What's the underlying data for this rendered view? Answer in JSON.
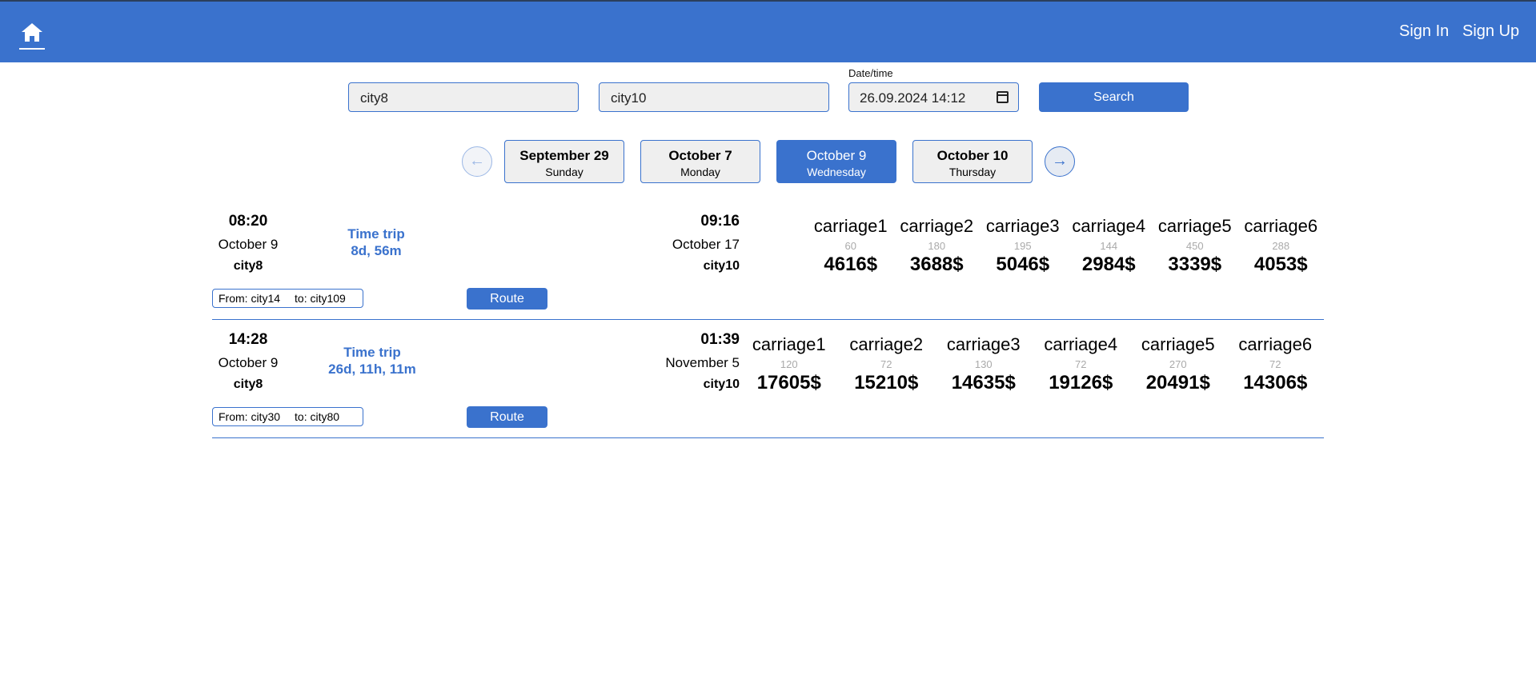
{
  "header": {
    "sign_in": "Sign In",
    "sign_up": "Sign Up"
  },
  "search": {
    "from": "city8",
    "to": "city10",
    "date_label": "Date/time",
    "date_value": "26.09.2024 14:12",
    "button": "Search"
  },
  "dates": [
    {
      "date": "September 29",
      "weekday": "Sunday"
    },
    {
      "date": "October 7",
      "weekday": "Monday"
    },
    {
      "date": "October 9",
      "weekday": "Wednesday"
    },
    {
      "date": "October 10",
      "weekday": "Thursday"
    }
  ],
  "trips": [
    {
      "dep_time": "08:20",
      "dep_date": "October 9",
      "dep_city": "city8",
      "time_trip_label": "Time trip",
      "duration": "8d, 56m",
      "arr_time": "09:16",
      "arr_date": "October 17",
      "arr_city": "city10",
      "from": "From: city14",
      "to": "to: city109",
      "route": "Route",
      "carriages": [
        {
          "name": "carriage1",
          "seats": "60",
          "price": "4616$"
        },
        {
          "name": "carriage2",
          "seats": "180",
          "price": "3688$"
        },
        {
          "name": "carriage3",
          "seats": "195",
          "price": "5046$"
        },
        {
          "name": "carriage4",
          "seats": "144",
          "price": "2984$"
        },
        {
          "name": "carriage5",
          "seats": "450",
          "price": "3339$"
        },
        {
          "name": "carriage6",
          "seats": "288",
          "price": "4053$"
        }
      ]
    },
    {
      "dep_time": "14:28",
      "dep_date": "October 9",
      "dep_city": "city8",
      "time_trip_label": "Time trip",
      "duration": "26d, 11h, 11m",
      "arr_time": "01:39",
      "arr_date": "November 5",
      "arr_city": "city10",
      "from": "From: city30",
      "to": "to: city80",
      "route": "Route",
      "carriages": [
        {
          "name": "carriage1",
          "seats": "120",
          "price": "17605$"
        },
        {
          "name": "carriage2",
          "seats": "72",
          "price": "15210$"
        },
        {
          "name": "carriage3",
          "seats": "130",
          "price": "14635$"
        },
        {
          "name": "carriage4",
          "seats": "72",
          "price": "19126$"
        },
        {
          "name": "carriage5",
          "seats": "270",
          "price": "20491$"
        },
        {
          "name": "carriage6",
          "seats": "72",
          "price": "14306$"
        }
      ]
    }
  ]
}
